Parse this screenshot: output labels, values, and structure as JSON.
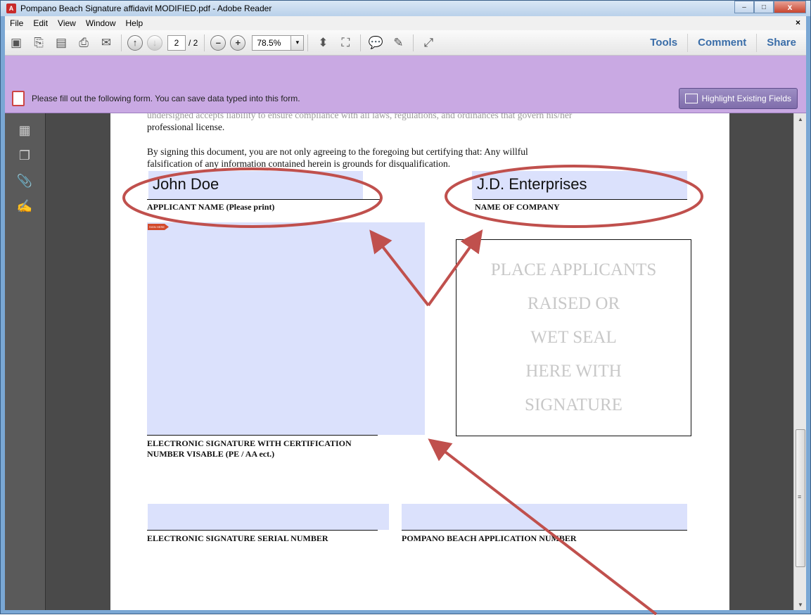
{
  "window": {
    "title": "Pompano Beach Signature affidavit MODIFIED.pdf - Adobe Reader",
    "app_icon": "pdf-icon",
    "minimize": "–",
    "maximize": "□",
    "close": "x"
  },
  "menu": {
    "items": [
      "File",
      "Edit",
      "View",
      "Window",
      "Help"
    ],
    "close": "×"
  },
  "toolbar": {
    "page_current": "2",
    "page_total": "/ 2",
    "zoom": "78.5%",
    "zoom_drop": "▾",
    "zoom_out": "–",
    "zoom_in": "+",
    "prev_page": "↑",
    "next_page": "↓",
    "tools": "Tools",
    "comment": "Comment",
    "share": "Share"
  },
  "formbar": {
    "message": "Please fill out the following form. You can save data typed into this form.",
    "highlight_button": "Highlight Existing Fields"
  },
  "document": {
    "partial_line": "undersigned accepts liability to ensure compliance with all laws, regulations, and ordinances that govern his/her",
    "professional_license": "professional license.",
    "certify_line1": "By signing this document, you are not only agreeing to the foregoing but certifying that: Any willful",
    "certify_line2": "falsification of any information contained herein is grounds for disqualification.",
    "applicant_name_value": "John Doe",
    "applicant_name_label": "APPLICANT NAME (Please print)",
    "company_value": "J.D. Enterprises",
    "company_label": "NAME OF COMPANY",
    "sign_here_tag": "SIGN HERE",
    "seal_lines": [
      "PLACE APPLICANTS",
      "RAISED OR",
      "WET SEAL",
      "HERE WITH",
      "SIGNATURE"
    ],
    "esig_label_line1": "ELECTRONIC SIGNATURE WITH CERTIFICATION",
    "esig_label_line2": "NUMBER VISABLE (PE / AA ect.)",
    "serial_label": "ELECTRONIC SIGNATURE SERIAL NUMBER",
    "app_number_label": "POMPANO BEACH APPLICATION NUMBER"
  },
  "scrollbar": {
    "up": "▲",
    "down": "▼",
    "grip": "≡"
  },
  "annotation_color": "#c0504d"
}
